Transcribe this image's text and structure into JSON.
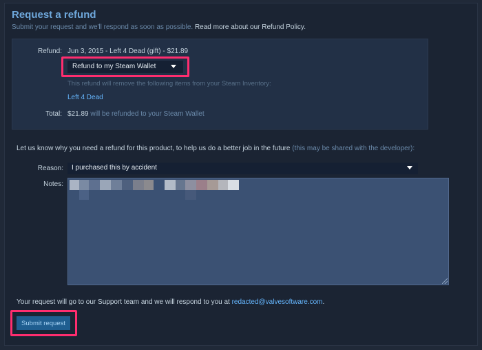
{
  "header": {
    "title": "Request a refund",
    "subtitle": "Submit your request and we'll respond as soon as possible.",
    "policy_link": "Read more about our Refund Policy."
  },
  "summary": {
    "refund_label": "Refund:",
    "refund_value": "Jun 3, 2015 - Left 4 Dead (gift) - $21.89",
    "method_selected": "Refund to my Steam Wallet",
    "removal_note": "This refund will remove the following items from your Steam Inventory:",
    "item": "Left 4 Dead",
    "total_label": "Total:",
    "total_amount": "$21.89",
    "total_note": "will be refunded to your Steam Wallet"
  },
  "form": {
    "why_text": "Let us know why you need a refund for this product, to help us do a better job in the future",
    "why_note": "(this may be shared with the developer):",
    "reason_label": "Reason:",
    "reason_selected": "I purchased this by accident",
    "notes_label": "Notes:"
  },
  "footer": {
    "support_text": "Your request will go to our Support team and we will respond to you at",
    "email": "redacted@valvesoftware.com",
    "email_end": ".",
    "submit_label": "Submit request"
  },
  "colors": {
    "background": "#1b2433",
    "panel": "#223046",
    "accent_link": "#66b7ff",
    "highlight": "#ff2d6f",
    "button": "#1f5e90"
  },
  "icons": {
    "dropdown": "caret-down-icon",
    "resize": "resize-grip-icon"
  }
}
